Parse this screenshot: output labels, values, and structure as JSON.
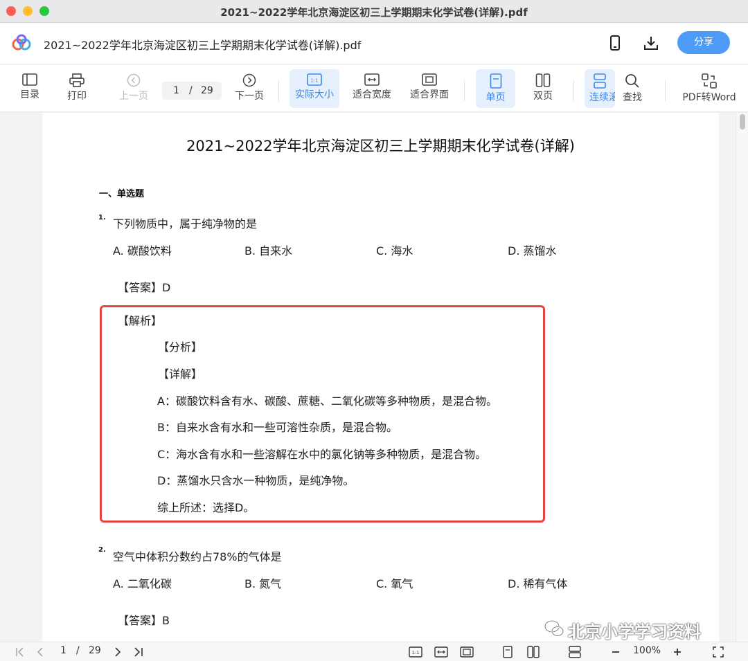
{
  "window": {
    "title": "2021~2022学年北京海淀区初三上学期期末化学试卷(详解).pdf"
  },
  "header": {
    "doc_title": "2021~2022学年北京海淀区初三上学期期末化学试卷(详解).pdf",
    "share_label": "分享"
  },
  "toolbar": {
    "toc": "目录",
    "print": "打印",
    "prev": "上一页",
    "current_page": "1",
    "page_sep": "/",
    "total_pages": "29",
    "next": "下一页",
    "actual_size": "实际大小",
    "fit_width": "适合宽度",
    "fit_window": "适合界面",
    "single_page": "单页",
    "double_page": "双页",
    "continuous": "连续滚",
    "search": "查找",
    "pdf_to_word": "PDF转Word"
  },
  "document": {
    "title": "2021~2022学年北京海淀区初三上学期期末化学试卷(详解)",
    "section": "一、单选题",
    "q1": {
      "num": "1.",
      "text": "下列物质中，属于纯净物的是",
      "options": [
        "A. 碳酸饮料",
        "B. 自来水",
        "C. 海水",
        "D. 蒸馏水"
      ],
      "answer": "【答案】D",
      "analysis_title": "【解析】",
      "lines": [
        "【分析】",
        "【详解】",
        "A：碳酸饮料含有水、碳酸、蔗糖、二氧化碳等多种物质，是混合物。",
        "B：自来水含有水和一些可溶性杂质，是混合物。",
        "C：海水含有水和一些溶解在水中的氯化钠等多种物质，是混合物。",
        "D：蒸馏水只含水一种物质，是纯净物。",
        "综上所述：选择D。"
      ]
    },
    "q2": {
      "num": "2.",
      "text": "空气中体积分数约占78%的气体是",
      "options": [
        "A. 二氧化碳",
        "B. 氮气",
        "C. 氧气",
        "D. 稀有气体"
      ],
      "answer": "【答案】B"
    },
    "watermark": "北京小学学习资料"
  },
  "bottombar": {
    "current_page": "1",
    "page_sep": "/",
    "total_pages": "29",
    "zoom": "100%",
    "actual_size_icon": "1:1"
  },
  "colors": {
    "accent": "#4c9bf6",
    "highlight_border": "#e2453c",
    "active_tool_bg": "#e6f0fd"
  }
}
